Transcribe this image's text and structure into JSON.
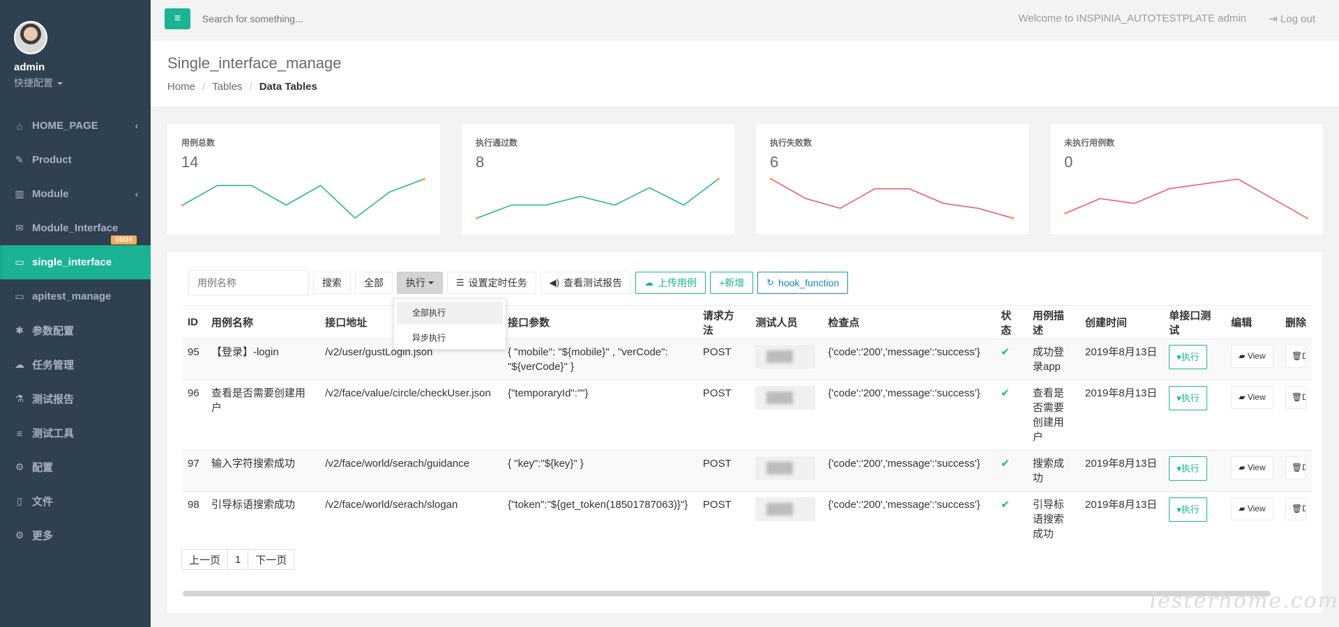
{
  "sidebar": {
    "profile_name": "admin",
    "profile_sub": "快捷配置",
    "items": [
      {
        "label": "HOME_PAGE",
        "icon": "home-icon",
        "glyph": "⌂",
        "arrow": "‹"
      },
      {
        "label": "Product",
        "icon": "edit-icon",
        "glyph": "✎",
        "arrow": ""
      },
      {
        "label": "Module",
        "icon": "bar-chart-icon",
        "glyph": "▥",
        "arrow": "‹"
      },
      {
        "label": "Module_Interface",
        "icon": "envelope-icon",
        "glyph": "✉",
        "arrow": "",
        "badge": "16/24"
      },
      {
        "label": "single_interface",
        "icon": "folder-open-icon",
        "glyph": "▭",
        "arrow": ""
      },
      {
        "label": "apitest_manage",
        "icon": "folder-open-icon",
        "glyph": "▭",
        "arrow": ""
      },
      {
        "label": "参数配置",
        "icon": "asterisk-icon",
        "glyph": "✱",
        "arrow": ""
      },
      {
        "label": "任务管理",
        "icon": "cloud-icon",
        "glyph": "☁",
        "arrow": ""
      },
      {
        "label": "测试报告",
        "icon": "flask-icon",
        "glyph": "⚗",
        "arrow": ""
      },
      {
        "label": "测试工具",
        "icon": "database-icon",
        "glyph": "≡",
        "arrow": ""
      },
      {
        "label": "配置",
        "icon": "gear-icon",
        "glyph": "⚙",
        "arrow": ""
      },
      {
        "label": "文件",
        "icon": "file-icon",
        "glyph": "▯",
        "arrow": ""
      },
      {
        "label": "更多",
        "icon": "cogs-icon",
        "glyph": "⚙",
        "arrow": ""
      }
    ]
  },
  "topbar": {
    "menu_icon": "≡",
    "search_placeholder": "Search for something...",
    "welcome": "Welcome to INSPINIA_AUTOTESTPLATE admin",
    "logout": "Log out",
    "logout_icon": "⇥"
  },
  "heading": {
    "title": "Single_interface_manage",
    "breadcrumb": [
      "Home",
      "Tables",
      "Data Tables"
    ],
    "sep": "/"
  },
  "stats": [
    {
      "label": "用例总数",
      "value": "14",
      "trend": [
        2,
        5,
        5,
        2,
        5,
        0,
        4,
        6
      ],
      "color": "#1ab394"
    },
    {
      "label": "执行通过数",
      "value": "8",
      "trend": [
        0,
        3,
        3,
        5,
        3,
        7,
        3,
        9
      ],
      "color": "#1ab394"
    },
    {
      "label": "执行失败数",
      "value": "6",
      "trend": [
        9,
        5,
        3,
        7,
        7,
        4,
        3,
        1
      ],
      "color": "#ed5565"
    },
    {
      "label": "未执行用例数",
      "value": "0",
      "trend": [
        1,
        4,
        3,
        6,
        7,
        8,
        4,
        0
      ],
      "color": "#ed5565"
    }
  ],
  "toolbar": {
    "case_name_placeholder": "用例名称",
    "search": "搜索",
    "all": "全部",
    "execute": "执行",
    "schedule": "设置定时任务",
    "view_report": "查看测试报告",
    "upload": "上传用例",
    "add": "+新增",
    "hook": "hook_function"
  },
  "dropdown": {
    "items": [
      "全部执行",
      "异步执行"
    ]
  },
  "table": {
    "headers": [
      "ID",
      "用例名称",
      "接口地址",
      "接口参数",
      "请求方法",
      "测试人员",
      "检查点",
      "状态",
      "用例描述",
      "创建时间",
      "单接口测试",
      "编辑",
      "删除"
    ],
    "rows": [
      {
        "id": "95",
        "name": "【登录】-login",
        "url": "/v2/user/gustLogin.json",
        "params": "{ \"mobile\": \"${mobile}\" , \"verCode\": \"${verCode}\" }",
        "method": "POST",
        "check": "{'code':'200','message':'success'}",
        "status": "✔",
        "desc": "成功登录app",
        "created": "2019年8月13日",
        "exec": "▾执行",
        "view": "View",
        "del": "D"
      },
      {
        "id": "96",
        "name": "查看是否需要创建用户",
        "url": "/v2/face/value/circle/checkUser.json",
        "params": "{\"temporaryId\":\"\"}",
        "method": "POST",
        "check": "{'code':'200','message':'success'}",
        "status": "✔",
        "desc": "查看是否需要创建用户",
        "created": "2019年8月13日",
        "exec": "▾执行",
        "view": "View",
        "del": "D"
      },
      {
        "id": "97",
        "name": "输入字符搜索成功",
        "url": "/v2/face/world/serach/guidance",
        "params": "{ \"key\":\"${key}\" }",
        "method": "POST",
        "check": "{'code':'200','message':'success'}",
        "status": "✔",
        "desc": "搜索成功",
        "created": "2019年8月13日",
        "exec": "▾执行",
        "view": "View",
        "del": "D"
      },
      {
        "id": "98",
        "name": "引导标语搜索成功",
        "url": "/v2/face/world/serach/slogan",
        "params": "{\"token\":\"${get_token(18501787063)}\"}",
        "method": "POST",
        "check": "{'code':'200','message':'success'}",
        "status": "✔",
        "desc": "引导标语搜索成功",
        "created": "2019年8月13日",
        "exec": "▾执行",
        "view": "View",
        "del": "D"
      }
    ]
  },
  "pager": {
    "prev": "上一页",
    "page": "1",
    "next": "下一页"
  },
  "watermark": "lesterhome.com"
}
